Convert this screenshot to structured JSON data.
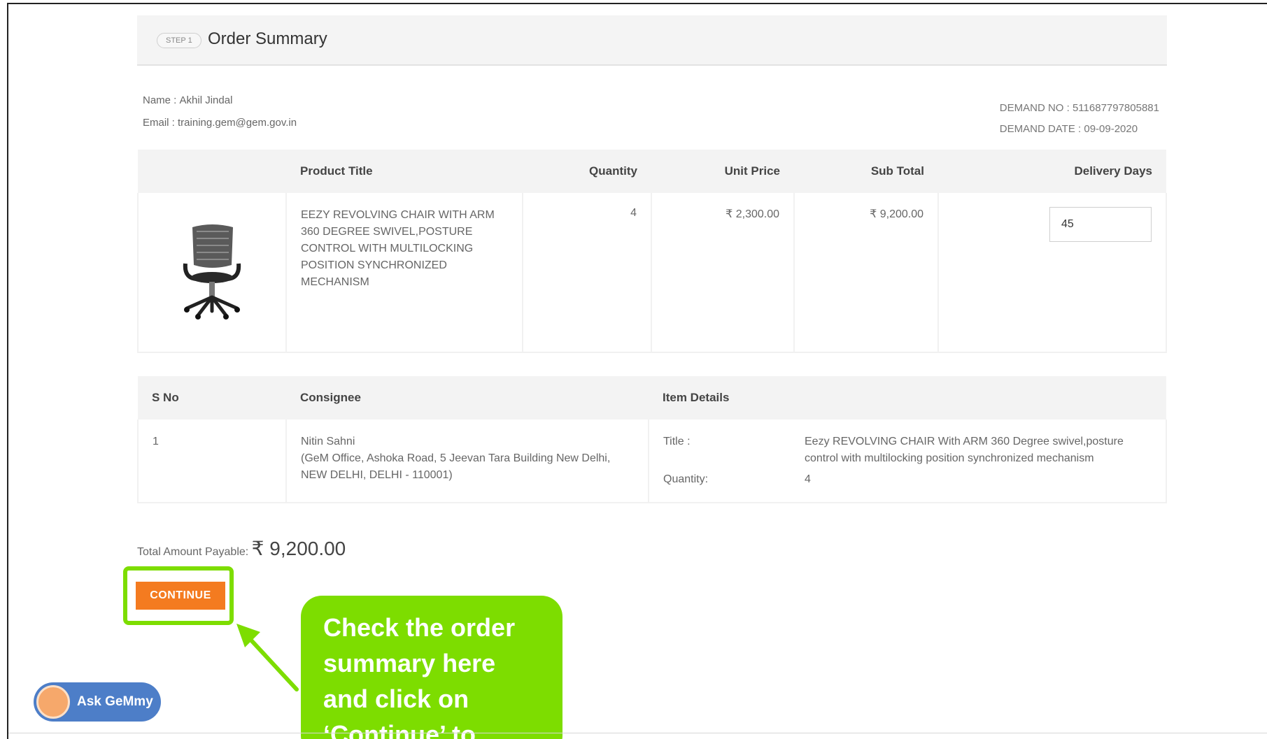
{
  "header": {
    "step": "STEP 1",
    "title": "Order Summary"
  },
  "user": {
    "name_label": "Name :",
    "name": "Akhil Jindal",
    "email_label": "Email :",
    "email": "training.gem@gem.gov.in"
  },
  "demand": {
    "no_label": "DEMAND NO :",
    "no": "511687797805881",
    "date_label": "DEMAND DATE :",
    "date": "09-09-2020"
  },
  "products": {
    "headers": [
      "Product Title",
      "Quantity",
      "Unit Price",
      "Sub Total",
      "Delivery Days"
    ],
    "row": {
      "title": "EEZY REVOLVING CHAIR WITH ARM 360 DEGREE SWIVEL,POSTURE CONTROL WITH MULTILOCKING POSITION SYNCHRONIZED MECHANISM",
      "quantity": "4",
      "unit_price": "₹ 2,300.00",
      "sub_total": "₹ 9,200.00",
      "delivery_days": "45"
    }
  },
  "consignee": {
    "headers": [
      "S No",
      "Consignee",
      "Item Details"
    ],
    "row": {
      "sno": "1",
      "name": "Nitin Sahni",
      "address": "(GeM Office, Ashoka Road, 5 Jeevan Tara Building New Delhi, NEW DELHI, DELHI - 110001)",
      "title_label": "Title :",
      "title": "Eezy REVOLVING CHAIR With ARM 360 Degree swivel,posture control with multilocking position synchronized mechanism",
      "qty_label": "Quantity:",
      "qty": "4"
    }
  },
  "total": {
    "label": "Total Amount Payable:",
    "amount": "₹ 9,200.00"
  },
  "actions": {
    "continue": "CONTINUE"
  },
  "callout": {
    "text": "Check the order summary here and click on ‘Continue’ to"
  },
  "assistant": {
    "label": "Ask GeMmy"
  },
  "colors": {
    "accent": "#f47b20",
    "highlight": "#7ddd00",
    "assistant": "#4d7ec8"
  }
}
